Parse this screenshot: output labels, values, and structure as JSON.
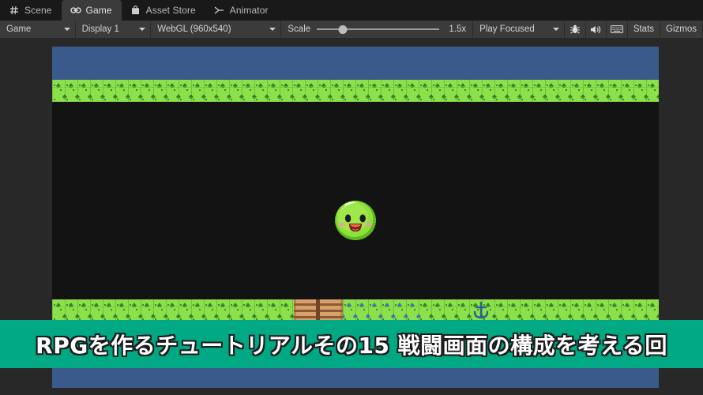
{
  "window": {
    "tabs": [
      {
        "label": "Scene",
        "icon": "grid-icon",
        "active": false
      },
      {
        "label": "Game",
        "icon": "gamepad-icon",
        "active": true
      },
      {
        "label": "Asset Store",
        "icon": "shopping-bag-icon",
        "active": false
      },
      {
        "label": "Animator",
        "icon": "animator-icon",
        "active": false
      }
    ]
  },
  "toolbar": {
    "view_dropdown": "Game",
    "display_dropdown": "Display 1",
    "resolution_dropdown": "WebGL (960x540)",
    "scale_label": "Scale",
    "scale_value": "1.5x",
    "scale_percent": 21,
    "play_mode_dropdown": "Play Focused",
    "icons": [
      {
        "name": "bug-icon",
        "glyph": "bug"
      },
      {
        "name": "mute-audio-icon",
        "glyph": "speaker"
      },
      {
        "name": "keyboard-icon",
        "glyph": "keyboard"
      }
    ],
    "stats_label": "Stats",
    "gizmos_label": "Gizmos"
  },
  "game_view": {
    "colors": {
      "water": "#3a5a8c",
      "grass": "#8ce04a",
      "background": "#131313",
      "bridge": "#d9a06a",
      "slime_body": "#7ed321",
      "gizmo": "#2a5f96"
    },
    "objects": [
      {
        "name": "water-strip-top",
        "type": "tilemap-water"
      },
      {
        "name": "grass-strip-top",
        "type": "tilemap-grass"
      },
      {
        "name": "slime-enemy",
        "type": "sprite"
      },
      {
        "name": "grass-strip-bottom",
        "type": "tilemap-grass"
      },
      {
        "name": "wooden-bridge",
        "type": "tilemap-bridge"
      },
      {
        "name": "anchor-gizmo",
        "type": "gizmo"
      },
      {
        "name": "water-strip-bottom",
        "type": "tilemap-water"
      }
    ]
  },
  "banner": {
    "text": "RPGを作るチュートリアルその15 戦闘画面の構成を考える回",
    "background_color": "#00a884",
    "text_color": "#ffffff"
  }
}
